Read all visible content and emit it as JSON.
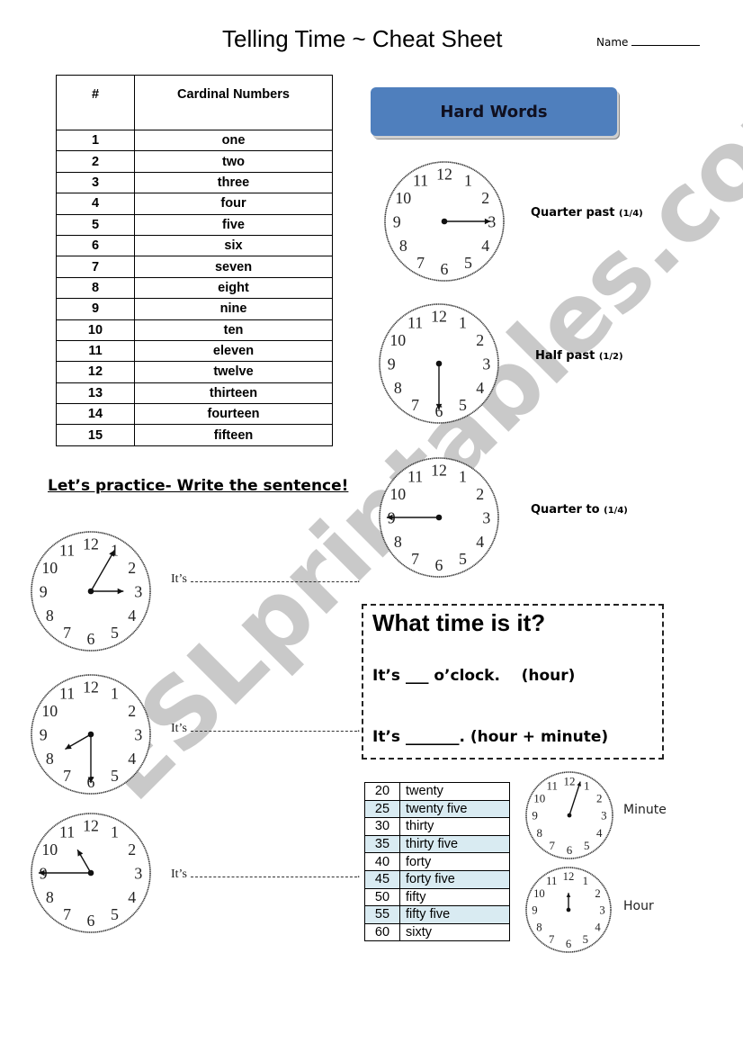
{
  "header": {
    "title": "Telling Time ~ Cheat Sheet",
    "name_label": "Name"
  },
  "cardinal_table": {
    "headers": [
      "#",
      "Cardinal Numbers"
    ],
    "rows": [
      [
        "1",
        "one"
      ],
      [
        "2",
        "two"
      ],
      [
        "3",
        "three"
      ],
      [
        "4",
        "four"
      ],
      [
        "5",
        "five"
      ],
      [
        "6",
        "six"
      ],
      [
        "7",
        "seven"
      ],
      [
        "8",
        "eight"
      ],
      [
        "9",
        "nine"
      ],
      [
        "10",
        "ten"
      ],
      [
        "11",
        "eleven"
      ],
      [
        "12",
        "twelve"
      ],
      [
        "13",
        "thirteen"
      ],
      [
        "14",
        "fourteen"
      ],
      [
        "15",
        "fifteen"
      ]
    ]
  },
  "hard_words": {
    "title": "Hard Words",
    "box_color": "#4f7fbd",
    "items": [
      {
        "label": "Quarter past",
        "fraction": "(1/4)",
        "minute_hand_at": 3
      },
      {
        "label": "Half past",
        "fraction": "(1/2)",
        "minute_hand_at": 6
      },
      {
        "label": "Quarter to",
        "fraction": "(1/4)",
        "minute_hand_at": 9
      }
    ]
  },
  "practice": {
    "heading": "Let’s practice- Write the sentence!",
    "prompt": "It’s",
    "clocks": [
      {
        "hour_hand_at": 3,
        "minute_hand_at": 1
      },
      {
        "hour_hand_at": 8,
        "minute_hand_at": 6
      },
      {
        "hour_hand_at": 11,
        "minute_hand_at": 9
      }
    ]
  },
  "what_time": {
    "title": "What time is it?",
    "line1": "It’s ___ o’clock.    (hour)",
    "line2": "It’s _______. (hour + minute)"
  },
  "minutes_table": {
    "rows": [
      [
        "20",
        "twenty"
      ],
      [
        "25",
        "twenty five"
      ],
      [
        "30",
        "thirty"
      ],
      [
        "35",
        "thirty five"
      ],
      [
        "40",
        "forty"
      ],
      [
        "45",
        "forty five"
      ],
      [
        "50",
        "fifty"
      ],
      [
        "55",
        "fifty five"
      ],
      [
        "60",
        "sixty"
      ]
    ],
    "shade_color": "#d9ebf2"
  },
  "hand_examples": [
    {
      "label": "Minute",
      "hand_at": 0.6
    },
    {
      "label": "Hour",
      "hand_at": 12
    }
  ],
  "clock_numerals": [
    "12",
    "1",
    "2",
    "3",
    "4",
    "5",
    "6",
    "7",
    "8",
    "9",
    "10",
    "11"
  ],
  "watermark": "ESLprintables.com"
}
